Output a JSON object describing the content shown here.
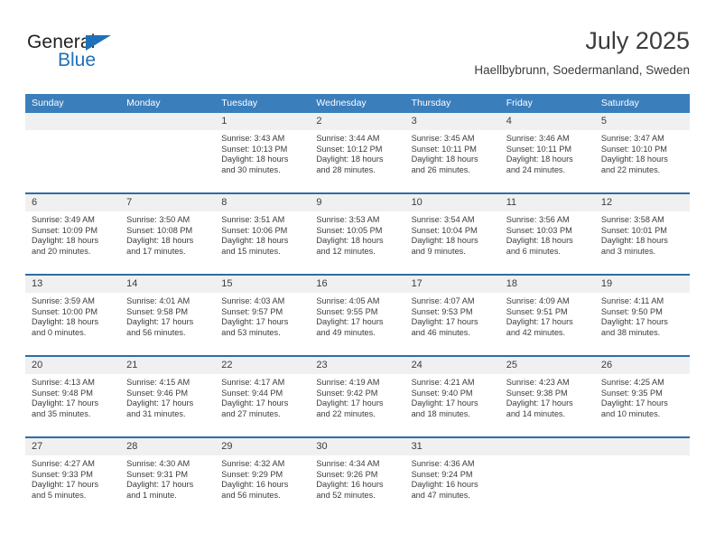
{
  "logo": {
    "text_dark": "General",
    "text_blue": "Blue",
    "triangle_color": "#1e71b8"
  },
  "header": {
    "title": "July 2025",
    "subtitle": "Haellbybrunn, Soedermanland, Sweden"
  },
  "theme": {
    "header_blue": "#3b7ebc",
    "row_divider_blue": "#2e6da4",
    "daynum_band": "#f0f0f0",
    "text": "#3c3c3c"
  },
  "calendar": {
    "weekdays": [
      "Sunday",
      "Monday",
      "Tuesday",
      "Wednesday",
      "Thursday",
      "Friday",
      "Saturday"
    ],
    "weeks": [
      [
        {
          "day": "",
          "sunrise": "",
          "sunset": "",
          "daylight1": "",
          "daylight2": ""
        },
        {
          "day": "",
          "sunrise": "",
          "sunset": "",
          "daylight1": "",
          "daylight2": ""
        },
        {
          "day": "1",
          "sunrise": "Sunrise: 3:43 AM",
          "sunset": "Sunset: 10:13 PM",
          "daylight1": "Daylight: 18 hours",
          "daylight2": "and 30 minutes."
        },
        {
          "day": "2",
          "sunrise": "Sunrise: 3:44 AM",
          "sunset": "Sunset: 10:12 PM",
          "daylight1": "Daylight: 18 hours",
          "daylight2": "and 28 minutes."
        },
        {
          "day": "3",
          "sunrise": "Sunrise: 3:45 AM",
          "sunset": "Sunset: 10:11 PM",
          "daylight1": "Daylight: 18 hours",
          "daylight2": "and 26 minutes."
        },
        {
          "day": "4",
          "sunrise": "Sunrise: 3:46 AM",
          "sunset": "Sunset: 10:11 PM",
          "daylight1": "Daylight: 18 hours",
          "daylight2": "and 24 minutes."
        },
        {
          "day": "5",
          "sunrise": "Sunrise: 3:47 AM",
          "sunset": "Sunset: 10:10 PM",
          "daylight1": "Daylight: 18 hours",
          "daylight2": "and 22 minutes."
        }
      ],
      [
        {
          "day": "6",
          "sunrise": "Sunrise: 3:49 AM",
          "sunset": "Sunset: 10:09 PM",
          "daylight1": "Daylight: 18 hours",
          "daylight2": "and 20 minutes."
        },
        {
          "day": "7",
          "sunrise": "Sunrise: 3:50 AM",
          "sunset": "Sunset: 10:08 PM",
          "daylight1": "Daylight: 18 hours",
          "daylight2": "and 17 minutes."
        },
        {
          "day": "8",
          "sunrise": "Sunrise: 3:51 AM",
          "sunset": "Sunset: 10:06 PM",
          "daylight1": "Daylight: 18 hours",
          "daylight2": "and 15 minutes."
        },
        {
          "day": "9",
          "sunrise": "Sunrise: 3:53 AM",
          "sunset": "Sunset: 10:05 PM",
          "daylight1": "Daylight: 18 hours",
          "daylight2": "and 12 minutes."
        },
        {
          "day": "10",
          "sunrise": "Sunrise: 3:54 AM",
          "sunset": "Sunset: 10:04 PM",
          "daylight1": "Daylight: 18 hours",
          "daylight2": "and 9 minutes."
        },
        {
          "day": "11",
          "sunrise": "Sunrise: 3:56 AM",
          "sunset": "Sunset: 10:03 PM",
          "daylight1": "Daylight: 18 hours",
          "daylight2": "and 6 minutes."
        },
        {
          "day": "12",
          "sunrise": "Sunrise: 3:58 AM",
          "sunset": "Sunset: 10:01 PM",
          "daylight1": "Daylight: 18 hours",
          "daylight2": "and 3 minutes."
        }
      ],
      [
        {
          "day": "13",
          "sunrise": "Sunrise: 3:59 AM",
          "sunset": "Sunset: 10:00 PM",
          "daylight1": "Daylight: 18 hours",
          "daylight2": "and 0 minutes."
        },
        {
          "day": "14",
          "sunrise": "Sunrise: 4:01 AM",
          "sunset": "Sunset: 9:58 PM",
          "daylight1": "Daylight: 17 hours",
          "daylight2": "and 56 minutes."
        },
        {
          "day": "15",
          "sunrise": "Sunrise: 4:03 AM",
          "sunset": "Sunset: 9:57 PM",
          "daylight1": "Daylight: 17 hours",
          "daylight2": "and 53 minutes."
        },
        {
          "day": "16",
          "sunrise": "Sunrise: 4:05 AM",
          "sunset": "Sunset: 9:55 PM",
          "daylight1": "Daylight: 17 hours",
          "daylight2": "and 49 minutes."
        },
        {
          "day": "17",
          "sunrise": "Sunrise: 4:07 AM",
          "sunset": "Sunset: 9:53 PM",
          "daylight1": "Daylight: 17 hours",
          "daylight2": "and 46 minutes."
        },
        {
          "day": "18",
          "sunrise": "Sunrise: 4:09 AM",
          "sunset": "Sunset: 9:51 PM",
          "daylight1": "Daylight: 17 hours",
          "daylight2": "and 42 minutes."
        },
        {
          "day": "19",
          "sunrise": "Sunrise: 4:11 AM",
          "sunset": "Sunset: 9:50 PM",
          "daylight1": "Daylight: 17 hours",
          "daylight2": "and 38 minutes."
        }
      ],
      [
        {
          "day": "20",
          "sunrise": "Sunrise: 4:13 AM",
          "sunset": "Sunset: 9:48 PM",
          "daylight1": "Daylight: 17 hours",
          "daylight2": "and 35 minutes."
        },
        {
          "day": "21",
          "sunrise": "Sunrise: 4:15 AM",
          "sunset": "Sunset: 9:46 PM",
          "daylight1": "Daylight: 17 hours",
          "daylight2": "and 31 minutes."
        },
        {
          "day": "22",
          "sunrise": "Sunrise: 4:17 AM",
          "sunset": "Sunset: 9:44 PM",
          "daylight1": "Daylight: 17 hours",
          "daylight2": "and 27 minutes."
        },
        {
          "day": "23",
          "sunrise": "Sunrise: 4:19 AM",
          "sunset": "Sunset: 9:42 PM",
          "daylight1": "Daylight: 17 hours",
          "daylight2": "and 22 minutes."
        },
        {
          "day": "24",
          "sunrise": "Sunrise: 4:21 AM",
          "sunset": "Sunset: 9:40 PM",
          "daylight1": "Daylight: 17 hours",
          "daylight2": "and 18 minutes."
        },
        {
          "day": "25",
          "sunrise": "Sunrise: 4:23 AM",
          "sunset": "Sunset: 9:38 PM",
          "daylight1": "Daylight: 17 hours",
          "daylight2": "and 14 minutes."
        },
        {
          "day": "26",
          "sunrise": "Sunrise: 4:25 AM",
          "sunset": "Sunset: 9:35 PM",
          "daylight1": "Daylight: 17 hours",
          "daylight2": "and 10 minutes."
        }
      ],
      [
        {
          "day": "27",
          "sunrise": "Sunrise: 4:27 AM",
          "sunset": "Sunset: 9:33 PM",
          "daylight1": "Daylight: 17 hours",
          "daylight2": "and 5 minutes."
        },
        {
          "day": "28",
          "sunrise": "Sunrise: 4:30 AM",
          "sunset": "Sunset: 9:31 PM",
          "daylight1": "Daylight: 17 hours",
          "daylight2": "and 1 minute."
        },
        {
          "day": "29",
          "sunrise": "Sunrise: 4:32 AM",
          "sunset": "Sunset: 9:29 PM",
          "daylight1": "Daylight: 16 hours",
          "daylight2": "and 56 minutes."
        },
        {
          "day": "30",
          "sunrise": "Sunrise: 4:34 AM",
          "sunset": "Sunset: 9:26 PM",
          "daylight1": "Daylight: 16 hours",
          "daylight2": "and 52 minutes."
        },
        {
          "day": "31",
          "sunrise": "Sunrise: 4:36 AM",
          "sunset": "Sunset: 9:24 PM",
          "daylight1": "Daylight: 16 hours",
          "daylight2": "and 47 minutes."
        },
        {
          "day": "",
          "sunrise": "",
          "sunset": "",
          "daylight1": "",
          "daylight2": ""
        },
        {
          "day": "",
          "sunrise": "",
          "sunset": "",
          "daylight1": "",
          "daylight2": ""
        }
      ]
    ]
  }
}
